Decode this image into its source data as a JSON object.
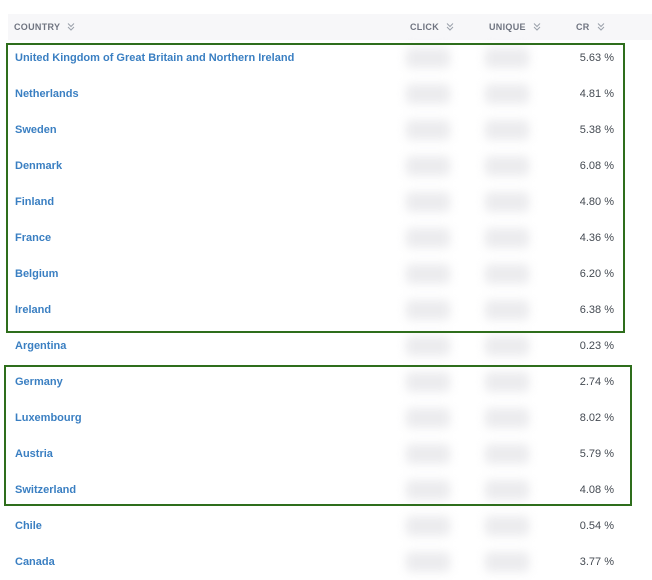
{
  "table": {
    "headers": {
      "country": "COUNTRY",
      "click": "CLICK",
      "unique": "UNIQUE",
      "cr": "CR"
    },
    "rows": [
      {
        "country": "United Kingdom of Great Britain and Northern Ireland",
        "cr": "5.63 %"
      },
      {
        "country": "Netherlands",
        "cr": "4.81 %"
      },
      {
        "country": "Sweden",
        "cr": "5.38 %"
      },
      {
        "country": "Denmark",
        "cr": "6.08 %"
      },
      {
        "country": "Finland",
        "cr": "4.80 %"
      },
      {
        "country": "France",
        "cr": "4.36 %"
      },
      {
        "country": "Belgium",
        "cr": "6.20 %"
      },
      {
        "country": "Ireland",
        "cr": "6.38 %"
      },
      {
        "country": "Argentina",
        "cr": "0.23 %"
      },
      {
        "country": "Germany",
        "cr": "2.74 %"
      },
      {
        "country": "Luxembourg",
        "cr": "8.02 %"
      },
      {
        "country": "Austria",
        "cr": "5.79 %"
      },
      {
        "country": "Switzerland",
        "cr": "4.08 %"
      },
      {
        "country": "Chile",
        "cr": "0.54 %"
      },
      {
        "country": "Canada",
        "cr": "3.77 %"
      }
    ]
  },
  "colors": {
    "link": "#3a7fc2",
    "highlight_border": "#2e6e1c",
    "header_bg": "#f7f7f9"
  },
  "icons": {
    "sort": "chevron-double-down-icon"
  }
}
